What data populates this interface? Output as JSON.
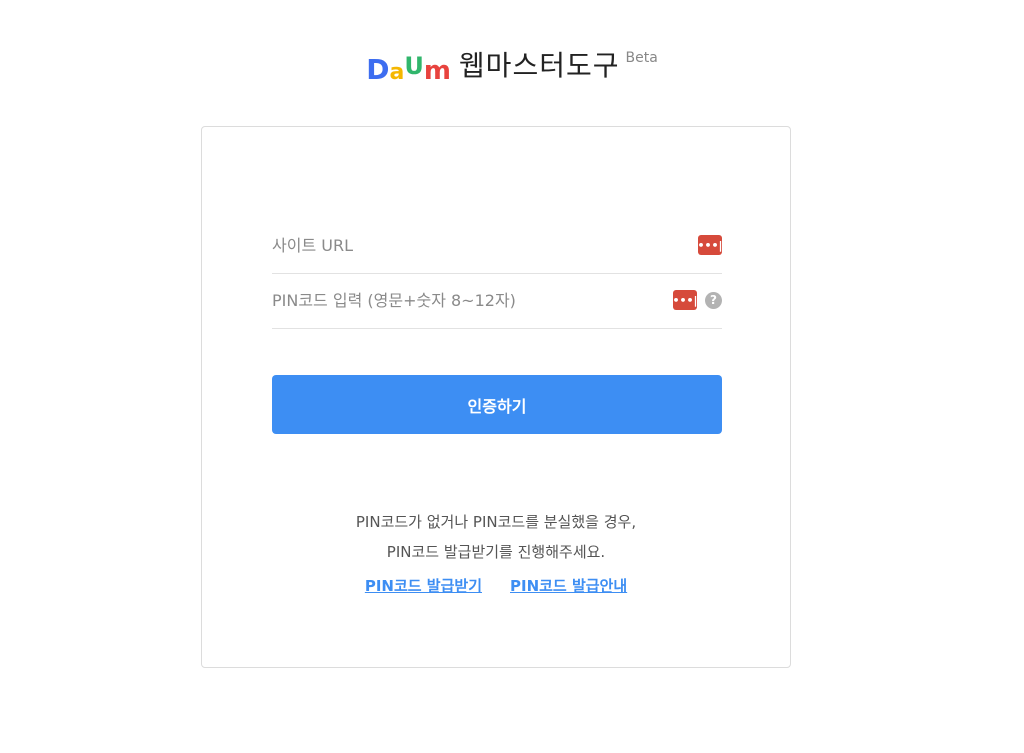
{
  "header": {
    "logo_letters": [
      "D",
      "a",
      "U",
      "m"
    ],
    "title": "웹마스터도구",
    "badge": "Beta"
  },
  "form": {
    "url_placeholder": "사이트 URL",
    "pin_placeholder": "PIN코드 입력 (영문+숫자 8~12자)",
    "password_icon_glyph": "•••|",
    "help_icon_glyph": "?",
    "submit_label": "인증하기"
  },
  "notice": {
    "line1": "PIN코드가 없거나 PIN코드를 분실했을 경우,",
    "line2": "PIN코드 발급받기를 진행해주세요."
  },
  "links": {
    "issue": "PIN코드 발급받기",
    "guide": "PIN코드 발급안내"
  },
  "colors": {
    "accent": "#3d8ef3",
    "password_icon": "#d64a3b",
    "logo_d": "#3d6df0",
    "logo_a": "#f5b700",
    "logo_u": "#31b66c",
    "logo_m": "#e8433e"
  }
}
